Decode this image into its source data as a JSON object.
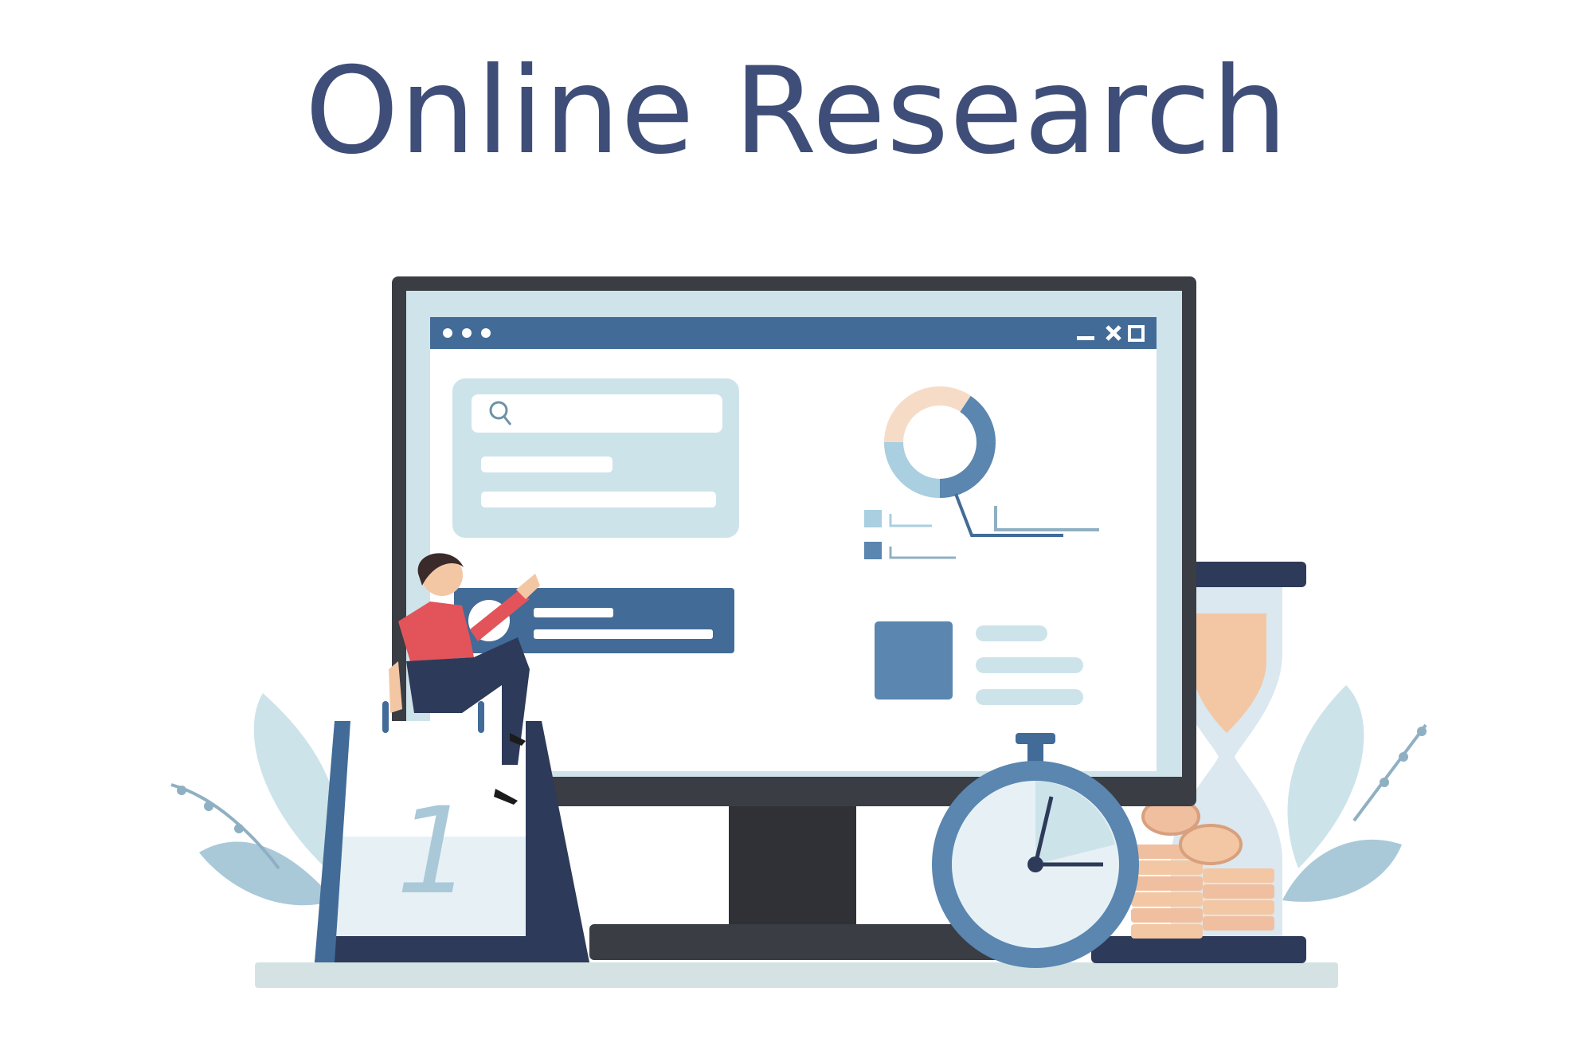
{
  "title": "Online Research",
  "calendar": {
    "day": "1"
  },
  "icons": {
    "window_controls": [
      "minimize-icon",
      "close-icon",
      "maximize-icon"
    ],
    "search": "search-icon",
    "donut_chart": "donut-chart-icon",
    "stopwatch": "stopwatch-icon",
    "hourglass": "hourglass-icon",
    "coins": "coin-stack-icon"
  },
  "colors": {
    "title": "#3e4e78",
    "screen_frame": "#3a3d44",
    "window_bar": "#426b98",
    "panel": "#cde3ea",
    "accent_dark": "#2e3a59",
    "skin_peach": "#f3c7a4",
    "shirt": "#e2545a"
  }
}
